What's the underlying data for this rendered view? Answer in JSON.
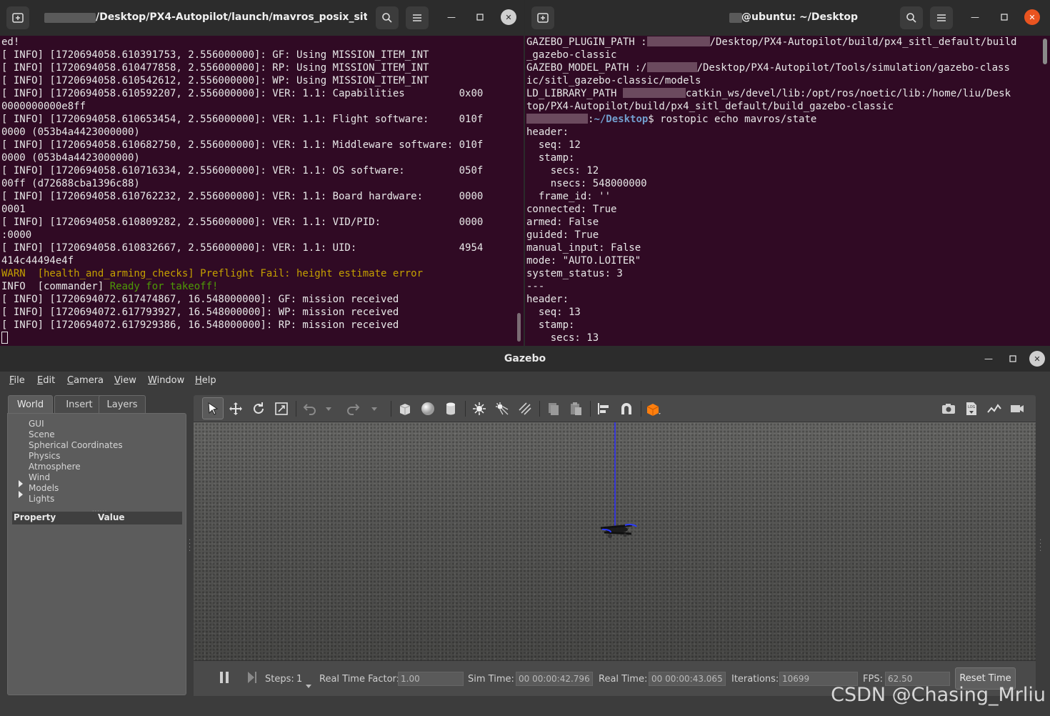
{
  "terminal_left": {
    "title": "/Desktop/PX4-Autopilot/launch/mavros_posix_sitl...",
    "lines": [
      [
        {
          "t": "ed!"
        }
      ],
      [
        {
          "t": "[ INFO] [1720694058.610391753, 2.556000000]: GF: Using MISSION_ITEM_INT"
        }
      ],
      [
        {
          "t": "[ INFO] [1720694058.610477858, 2.556000000]: RP: Using MISSION_ITEM_INT"
        }
      ],
      [
        {
          "t": "[ INFO] [1720694058.610542612, 2.556000000]: WP: Using MISSION_ITEM_INT"
        }
      ],
      [
        {
          "t": "[ INFO] [1720694058.610592207, 2.556000000]: VER: 1.1: Capabilities         0x00"
        }
      ],
      [
        {
          "t": "0000000000e8ff"
        }
      ],
      [
        {
          "t": "[ INFO] [1720694058.610653454, 2.556000000]: VER: 1.1: Flight software:     010f"
        }
      ],
      [
        {
          "t": "0000 (053b4a4423000000)"
        }
      ],
      [
        {
          "t": "[ INFO] [1720694058.610682750, 2.556000000]: VER: 1.1: Middleware software: 010f"
        }
      ],
      [
        {
          "t": "0000 (053b4a4423000000)"
        }
      ],
      [
        {
          "t": "[ INFO] [1720694058.610716334, 2.556000000]: VER: 1.1: OS software:         050f"
        }
      ],
      [
        {
          "t": "00ff (d72688cba1396c88)"
        }
      ],
      [
        {
          "t": "[ INFO] [1720694058.610762232, 2.556000000]: VER: 1.1: Board hardware:      0000"
        }
      ],
      [
        {
          "t": "0001"
        }
      ],
      [
        {
          "t": "[ INFO] [1720694058.610809282, 2.556000000]: VER: 1.1: VID/PID:             0000"
        }
      ],
      [
        {
          "t": ":0000"
        }
      ],
      [
        {
          "t": "[ INFO] [1720694058.610832667, 2.556000000]: VER: 1.1: UID:                 4954"
        }
      ],
      [
        {
          "t": "414c44494e4f"
        }
      ],
      [
        {
          "t": "WARN  [health_and_arming_checks] Preflight Fail: height estimate error",
          "c": "warn"
        }
      ],
      [
        {
          "t": "INFO  [commander] "
        },
        {
          "t": "Ready for takeoff!",
          "c": "okgreen"
        }
      ],
      [
        {
          "t": "[ INFO] [1720694072.617474867, 16.548000000]: GF: mission received"
        }
      ],
      [
        {
          "t": "[ INFO] [1720694072.617793927, 16.548000000]: WP: mission received"
        }
      ],
      [
        {
          "t": "[ INFO] [1720694072.617929386, 16.548000000]: RP: mission received"
        }
      ]
    ]
  },
  "terminal_right": {
    "title": "@ubuntu: ~/Desktop",
    "lines": [
      [
        {
          "t": "GAZEBO_PLUGIN_PATH :"
        },
        {
          "r": 88
        },
        {
          "t": "/Desktop/PX4-Autopilot/build/px4_sitl_default/build"
        }
      ],
      [
        {
          "t": "_gazebo-classic"
        }
      ],
      [
        {
          "t": "GAZEBO_MODEL_PATH :/"
        },
        {
          "r": 70
        },
        {
          "t": "/Desktop/PX4-Autopilot/Tools/simulation/gazebo-class"
        }
      ],
      [
        {
          "t": "ic/sitl_gazebo-classic/models"
        }
      ],
      [
        {
          "t": "LD_LIBRARY_PATH "
        },
        {
          "r": 88
        },
        {
          "t": "catkin_ws/devel/lib:/opt/ros/noetic/lib:/home/liu/Desk"
        }
      ],
      [
        {
          "t": "top/PX4-Autopilot/build/px4_sitl_default/build_gazebo-classic"
        }
      ],
      [
        {
          "r": 86
        },
        {
          "t": ":"
        },
        {
          "t": "~/Desktop",
          "c": "prompt-path"
        },
        {
          "t": "$ rostopic echo mavros/state"
        }
      ],
      [
        {
          "t": "header:"
        }
      ],
      [
        {
          "t": "  seq: 12"
        }
      ],
      [
        {
          "t": "  stamp:"
        }
      ],
      [
        {
          "t": "    secs: 12"
        }
      ],
      [
        {
          "t": "    nsecs: 548000000"
        }
      ],
      [
        {
          "t": "  frame_id: ''"
        }
      ],
      [
        {
          "t": "connected: True"
        }
      ],
      [
        {
          "t": "armed: False"
        }
      ],
      [
        {
          "t": "guided: True"
        }
      ],
      [
        {
          "t": "manual_input: False"
        }
      ],
      [
        {
          "t": "mode: \"AUTO.LOITER\""
        }
      ],
      [
        {
          "t": "system_status: 3"
        }
      ],
      [
        {
          "t": "---"
        }
      ],
      [
        {
          "t": "header:"
        }
      ],
      [
        {
          "t": "  seq: 13"
        }
      ],
      [
        {
          "t": "  stamp:"
        }
      ],
      [
        {
          "t": "    secs: 13"
        }
      ]
    ]
  },
  "gazebo": {
    "title": "Gazebo",
    "menu": [
      {
        "label": "File",
        "u": "F",
        "rest": "ile"
      },
      {
        "label": "Edit",
        "u": "E",
        "rest": "dit"
      },
      {
        "label": "Camera",
        "u": "C",
        "rest": "amera"
      },
      {
        "label": "View",
        "u": "V",
        "rest": "iew"
      },
      {
        "label": "Window",
        "u": "W",
        "rest": "indow"
      },
      {
        "label": "Help",
        "u": "H",
        "rest": "elp"
      }
    ],
    "tabs": [
      "World",
      "Insert",
      "Layers"
    ],
    "tree": [
      "GUI",
      "Scene",
      "Spherical Coordinates",
      "Physics",
      "Atmosphere",
      "Wind",
      "Models",
      "Lights"
    ],
    "property_header": {
      "property": "Property",
      "value": "Value"
    },
    "toolbar_icons": [
      "select-arrow-icon",
      "translate-icon",
      "rotate-icon",
      "scale-icon",
      "undo-icon",
      "undo-dropdown-icon",
      "redo-icon",
      "redo-dropdown-icon",
      "box-shape-icon",
      "sphere-shape-icon",
      "cylinder-shape-icon",
      "point-light-icon",
      "spot-light-icon",
      "directional-light-icon",
      "copy-icon",
      "paste-icon",
      "align-icon",
      "magnet-icon",
      "view-angle-icon",
      "screenshot-icon",
      "log-icon",
      "plot-icon",
      "video-record-icon"
    ],
    "bottom": {
      "steps_label": "Steps:",
      "steps_value": "1",
      "rtf_label": "Real Time Factor:",
      "rtf_value": "1.00",
      "sim_time_label": "Sim Time:",
      "sim_time_value": "00 00:00:42.796",
      "real_time_label": "Real Time:",
      "real_time_value": "00 00:00:43.065",
      "iterations_label": "Iterations:",
      "iterations_value": "10699",
      "fps_label": "FPS:",
      "fps_value": "62.50",
      "reset_label": "Reset Time"
    }
  },
  "watermark": "CSDN @Chasing_Mrliu",
  "colors": {
    "terminal_bg": "#300a24",
    "warn": "#c4a000",
    "ok_green": "#4e9a06",
    "prompt_path": "#729fcf",
    "accent_orange": "#e95420"
  }
}
